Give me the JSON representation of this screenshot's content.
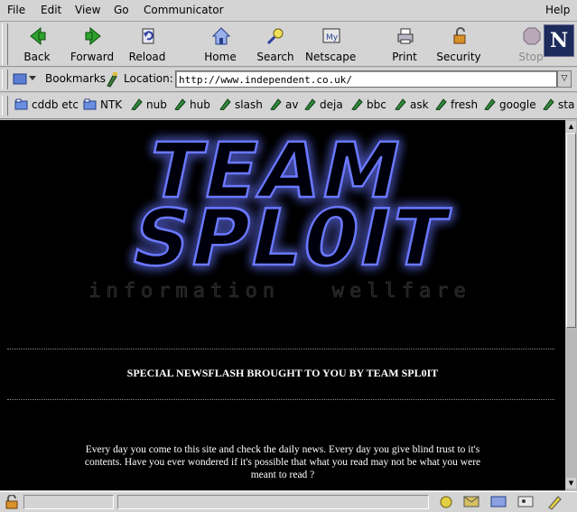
{
  "menu": {
    "left": [
      "File",
      "Edit",
      "View",
      "Go",
      "Communicator"
    ],
    "right": "Help"
  },
  "toolbar": {
    "buttons": [
      {
        "label": "Back",
        "icon": "back-arrow-icon"
      },
      {
        "label": "Forward",
        "icon": "forward-arrow-icon"
      },
      {
        "label": "Reload",
        "icon": "reload-icon"
      },
      {
        "label": "Home",
        "icon": "home-icon"
      },
      {
        "label": "Search",
        "icon": "search-icon"
      },
      {
        "label": "Netscape",
        "icon": "netscape-icon"
      },
      {
        "label": "Print",
        "icon": "print-icon"
      },
      {
        "label": "Security",
        "icon": "security-lock-icon"
      },
      {
        "label": "Stop",
        "icon": "stop-icon"
      }
    ],
    "logo": "N"
  },
  "location": {
    "bookmarks_label": "Bookmarks",
    "location_label": "Location:",
    "url": "http://www.independent.co.uk/"
  },
  "personal_toolbar": [
    {
      "label": "cddb etc",
      "icon": "folder-icon"
    },
    {
      "label": "NTK",
      "icon": "folder-icon"
    },
    {
      "label": "nub",
      "icon": "bookmark-icon"
    },
    {
      "label": "hub",
      "icon": "bookmark-icon"
    },
    {
      "label": "slash",
      "icon": "bookmark-icon"
    },
    {
      "label": "av",
      "icon": "bookmark-icon"
    },
    {
      "label": "deja",
      "icon": "bookmark-icon"
    },
    {
      "label": "bbc",
      "icon": "bookmark-icon"
    },
    {
      "label": "ask",
      "icon": "bookmark-icon"
    },
    {
      "label": "fresh",
      "icon": "bookmark-icon"
    },
    {
      "label": "google",
      "icon": "bookmark-icon"
    },
    {
      "label": "sta",
      "icon": "bookmark-icon"
    }
  ],
  "page": {
    "logo_line1": "TEAM",
    "logo_line2": "SPL0IT",
    "tagline": "information   wellfare",
    "newsflash": "SPECIAL NEWSFLASH BROUGHT TO YOU BY TEAM SPL0IT",
    "body": "Every day you come to this site and check the daily news. Every day you give blind trust to it's contents. Have you ever wondered if it's possible that what you read may not be what you were meant to read ?"
  },
  "colors": {
    "chrome": "#d4d4d4",
    "page_bg": "#000000",
    "logo_glow": "#3a4cff",
    "text": "#ffffff"
  }
}
